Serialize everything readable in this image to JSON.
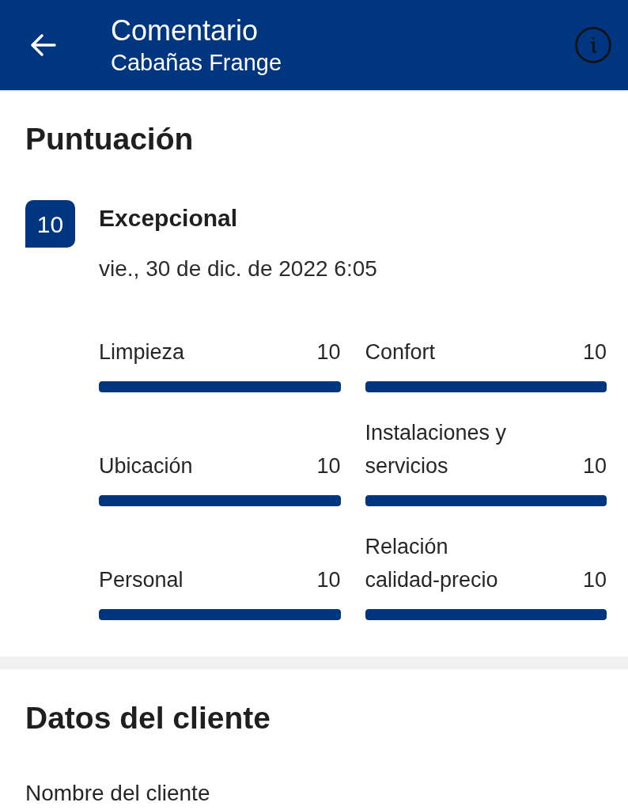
{
  "header": {
    "title": "Comentario",
    "subtitle": "Cabañas Frange"
  },
  "rating": {
    "heading": "Puntuación",
    "score": "10",
    "verdict": "Excepcional",
    "date": "vie., 30 de dic. de 2022 6:05",
    "categories": [
      {
        "label": "Limpieza",
        "score": "10",
        "level": 1
      },
      {
        "label": "Ubicación",
        "score": "10",
        "level": 1
      },
      {
        "label": "Personal",
        "score": "10",
        "level": 1
      },
      {
        "label": "Confort",
        "score": "10",
        "level": 1
      },
      {
        "label": "Instalaciones y servicios",
        "score": "10",
        "level": 1
      },
      {
        "label": "Relación calidad-precio",
        "score": "10",
        "level": 1
      }
    ]
  },
  "customer": {
    "heading": "Datos del cliente",
    "fields": [
      {
        "label": "Nombre del cliente"
      }
    ]
  }
}
